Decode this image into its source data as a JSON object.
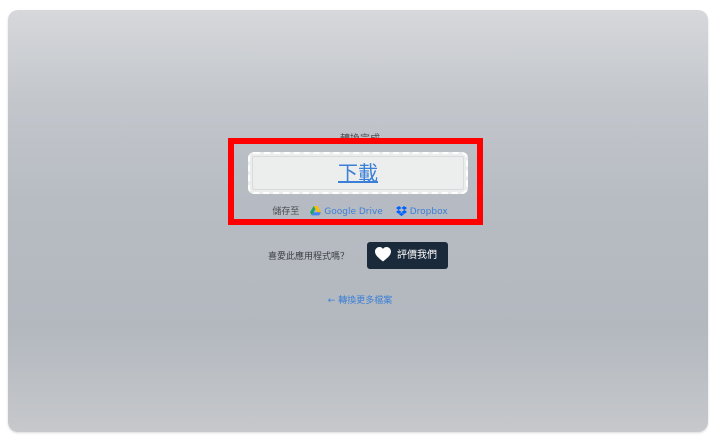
{
  "status": {
    "complete_text": "轉換完成"
  },
  "download": {
    "label": "下載"
  },
  "save_to": {
    "label": "儲存至",
    "services": [
      {
        "name": "Google Drive",
        "icon": "google-drive-icon"
      },
      {
        "name": "Dropbox",
        "icon": "dropbox-icon"
      }
    ]
  },
  "rating": {
    "prompt": "喜愛此應用程式嗎？",
    "button_label": "評價我們",
    "button_icon": "heart-icon"
  },
  "more": {
    "link_text": "← 轉換更多檔案"
  },
  "colors": {
    "highlight_border": "#ff0000",
    "link": "#3b7fd6",
    "rate_button_bg": "#1a2a3a"
  }
}
